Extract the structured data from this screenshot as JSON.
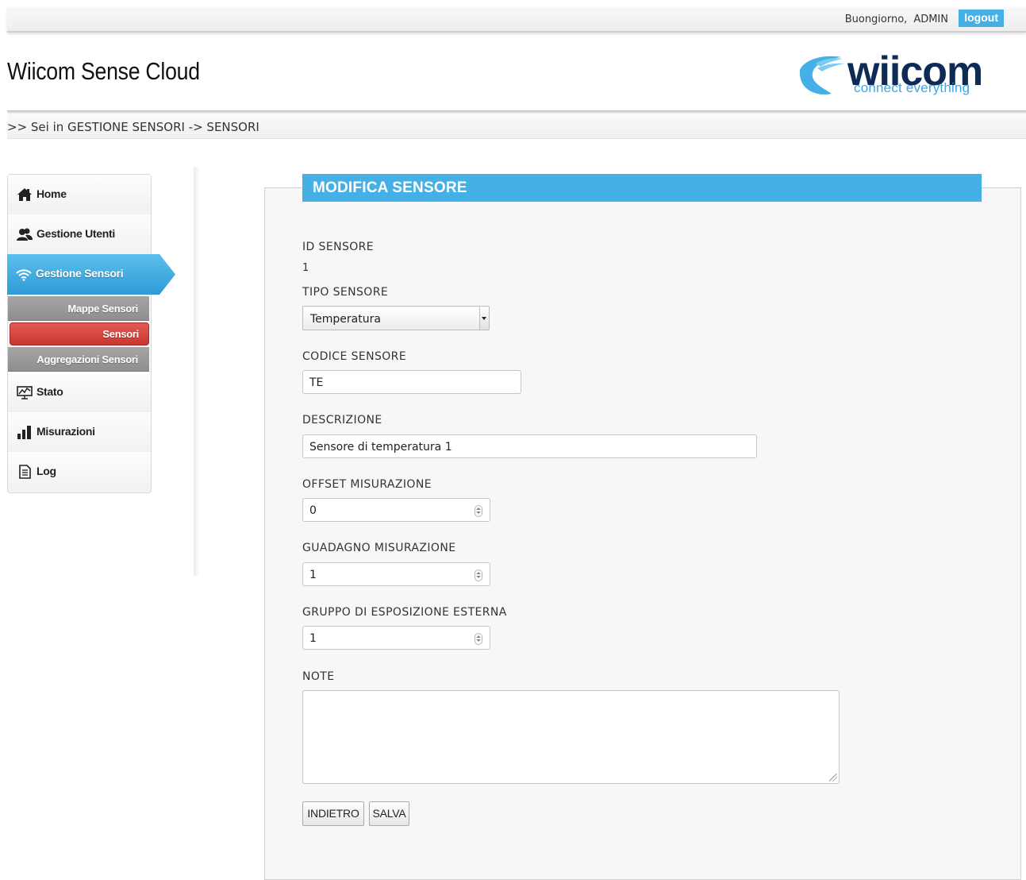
{
  "topbar": {
    "greeting": "Buongiorno,",
    "user": "ADMIN",
    "logout_label": "logout"
  },
  "header": {
    "app_title": "Wiicom Sense Cloud",
    "logo_word": "wiicom",
    "logo_tagline": "connect everything"
  },
  "breadcrumb": ">> Sei in GESTIONE SENSORI -> SENSORI",
  "sidebar": {
    "items": [
      {
        "label": "Home",
        "icon": "home-icon"
      },
      {
        "label": "Gestione Utenti",
        "icon": "users-icon"
      },
      {
        "label": "Gestione Sensori",
        "icon": "wifi-icon",
        "active": true
      },
      {
        "label": "Stato",
        "icon": "monitor-chart-icon"
      },
      {
        "label": "Misurazioni",
        "icon": "bar-chart-icon"
      },
      {
        "label": "Log",
        "icon": "document-icon"
      }
    ],
    "subitems": [
      {
        "label": "Mappe Sensori"
      },
      {
        "label": "Sensori",
        "active": true
      },
      {
        "label": "Aggregazioni Sensori"
      }
    ]
  },
  "form": {
    "title": "MODIFICA SENSORE",
    "id_label": "ID SENSORE",
    "id_value": "1",
    "type_label": "TIPO SENSORE",
    "type_value": "Temperatura",
    "code_label": "CODICE SENSORE",
    "code_value": "TE",
    "description_label": "DESCRIZIONE",
    "description_value": "Sensore di temperatura 1",
    "offset_label": "OFFSET MISURAZIONE",
    "offset_value": "0",
    "gain_label": "GUADAGNO MISURAZIONE",
    "gain_value": "1",
    "group_label": "GRUPPO DI ESPOSIZIONE ESTERNA",
    "group_value": "1",
    "notes_label": "NOTE",
    "notes_value": "",
    "back_label": "INDIETRO",
    "save_label": "SALVA"
  },
  "colors": {
    "accent": "#45b0e6",
    "active_sub": "#d9463f",
    "sub_bg": "#999999",
    "logo_dark": "#0d2b55"
  }
}
